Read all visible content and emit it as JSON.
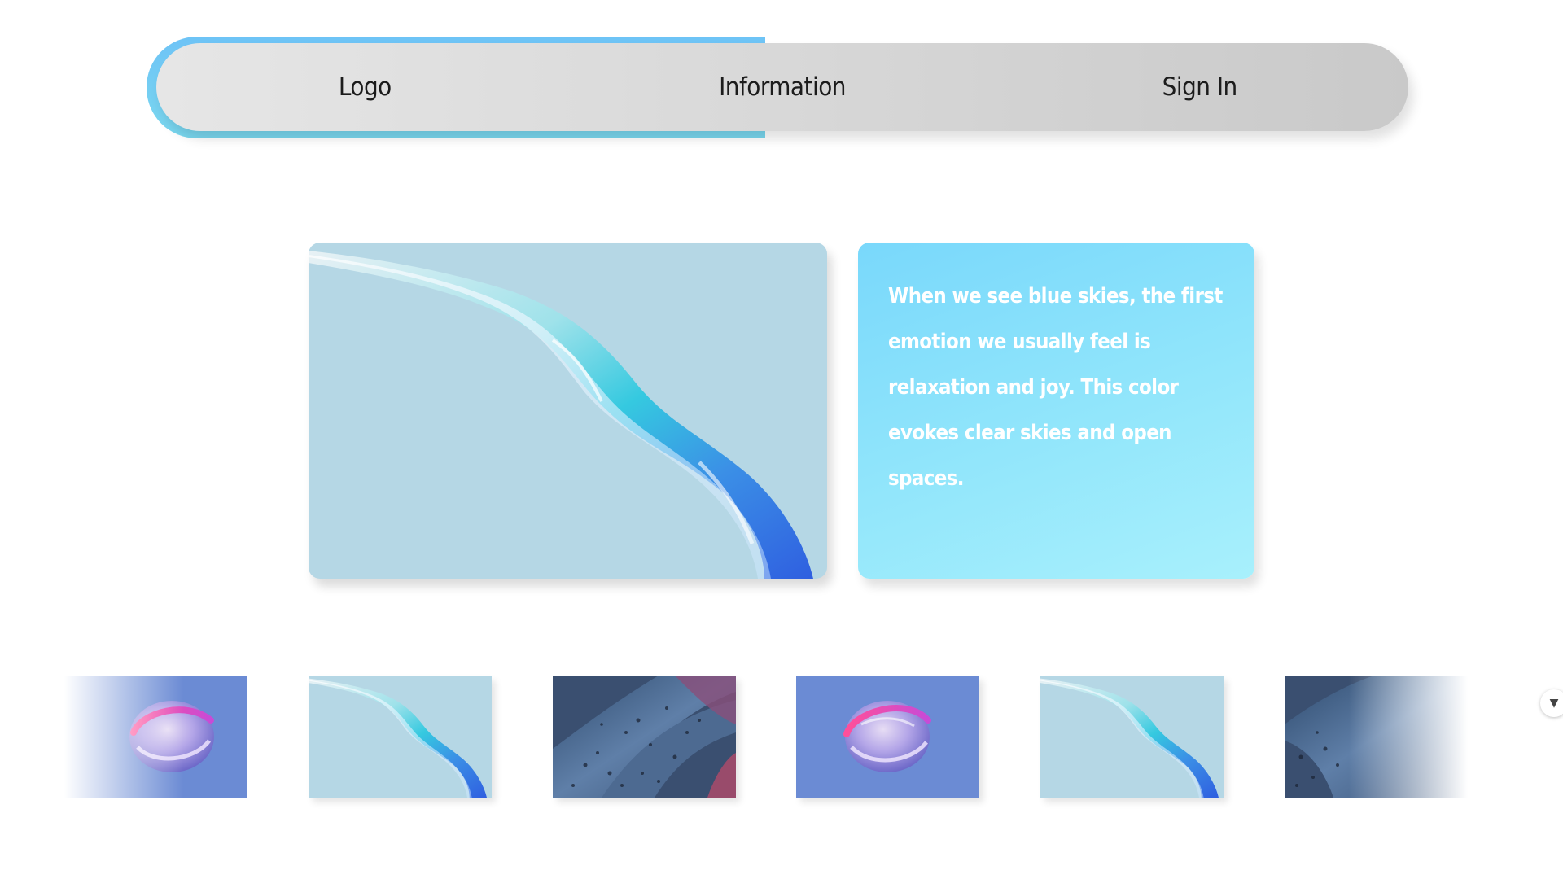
{
  "nav": {
    "items": [
      {
        "label": "Logo"
      },
      {
        "label": "Information"
      },
      {
        "label": "Sign In"
      }
    ]
  },
  "hero": {
    "image_icon": "blue-ribbon-artwork",
    "text": "When we see blue skies, the first emotion we usually feel is relaxation and joy. This color evokes clear skies and open spaces."
  },
  "gallery": {
    "thumbnails": [
      {
        "icon": "pink-sphere-artwork"
      },
      {
        "icon": "blue-ribbon-artwork"
      },
      {
        "icon": "dark-textured-waves-artwork"
      },
      {
        "icon": "pink-sphere-artwork"
      },
      {
        "icon": "blue-ribbon-artwork"
      },
      {
        "icon": "dark-textured-waves-artwork"
      }
    ],
    "scroll_icon": "chevron-down-icon"
  },
  "colors": {
    "accent": "#6ec3f6",
    "card": "#92e6fb",
    "image_bg": "#b5d7e5",
    "sphere_bg": "#6b8bd4"
  }
}
